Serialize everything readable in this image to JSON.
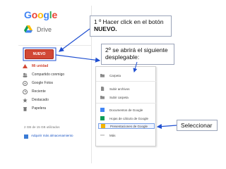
{
  "drive": {
    "logo": "Google",
    "title": "Drive",
    "new_button": "NUEVO",
    "nav": [
      {
        "label": "Mi unidad",
        "icon": "my-drive-icon"
      },
      {
        "label": "Compartido conmigo",
        "icon": "shared-icon"
      },
      {
        "label": "Google Fotos",
        "icon": "photos-icon"
      },
      {
        "label": "Reciente",
        "icon": "clock-icon"
      },
      {
        "label": "Destacado",
        "icon": "star-icon"
      },
      {
        "label": "Papelera",
        "icon": "trash-icon"
      }
    ],
    "storage": "2 GB de 15 GB utilizados",
    "buy_storage": "Adquirir más almacenamiento"
  },
  "menu": {
    "items": [
      {
        "label": "Carpeta",
        "icon": "folder-icon",
        "color": "#8a8a8a"
      },
      {
        "label": "Subir archivos",
        "icon": "file-upload-icon",
        "color": "#8a8a8a"
      },
      {
        "label": "Subir carpeta",
        "icon": "folder-upload-icon",
        "color": "#8a8a8a"
      },
      {
        "label": "Documentos de Google",
        "icon": "docs-icon",
        "color": "#4285f4"
      },
      {
        "label": "Hojas de cálculo de Google",
        "icon": "sheets-icon",
        "color": "#0f9d58"
      },
      {
        "label": "Presentaciones de Google",
        "icon": "slides-icon",
        "color": "#f4b400"
      },
      {
        "label": "Más",
        "icon": "more-icon",
        "color": "#8a8a8a"
      }
    ]
  },
  "callouts": {
    "step1_line1": "1 º Hacer click en el botón",
    "step1_line2": "NUEVO.",
    "step2": "2º se abrirá el siguiente desplegable:",
    "select": "Seleccionar"
  },
  "colors": {
    "new_button": "#d14836",
    "active_nav": "#d14836",
    "arrow": "#1f4fd1"
  }
}
